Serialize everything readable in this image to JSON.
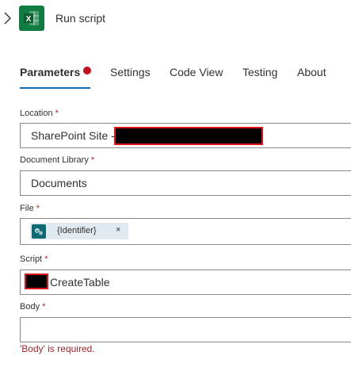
{
  "header": {
    "title": "Run script",
    "app_icon": "excel-icon",
    "expand_icon": "chevron-right-icon",
    "accent_color": "#107c41"
  },
  "tabs": [
    {
      "label": "Parameters",
      "active": true,
      "has_error": true
    },
    {
      "label": "Settings",
      "active": false
    },
    {
      "label": "Code View",
      "active": false
    },
    {
      "label": "Testing",
      "active": false
    },
    {
      "label": "About",
      "active": false
    }
  ],
  "fields": {
    "location": {
      "label": "Location",
      "required_mark": "*",
      "value": "SharePoint Site -"
    },
    "document_library": {
      "label": "Document Library",
      "required_mark": "*",
      "value": "Documents"
    },
    "file": {
      "label": "File",
      "required_mark": "*",
      "token_text": "{Identifier}",
      "token_close": "×",
      "token_icon": "sharepoint-icon"
    },
    "script": {
      "label": "Script",
      "required_mark": "*",
      "value": "CreateTable"
    },
    "body": {
      "label": "Body",
      "required_mark": "*",
      "value": "",
      "error": "'Body' is required."
    }
  },
  "colors": {
    "tab_underline": "#0f6cbd",
    "error": "#a4262c",
    "redaction_border": "#e0141a"
  }
}
